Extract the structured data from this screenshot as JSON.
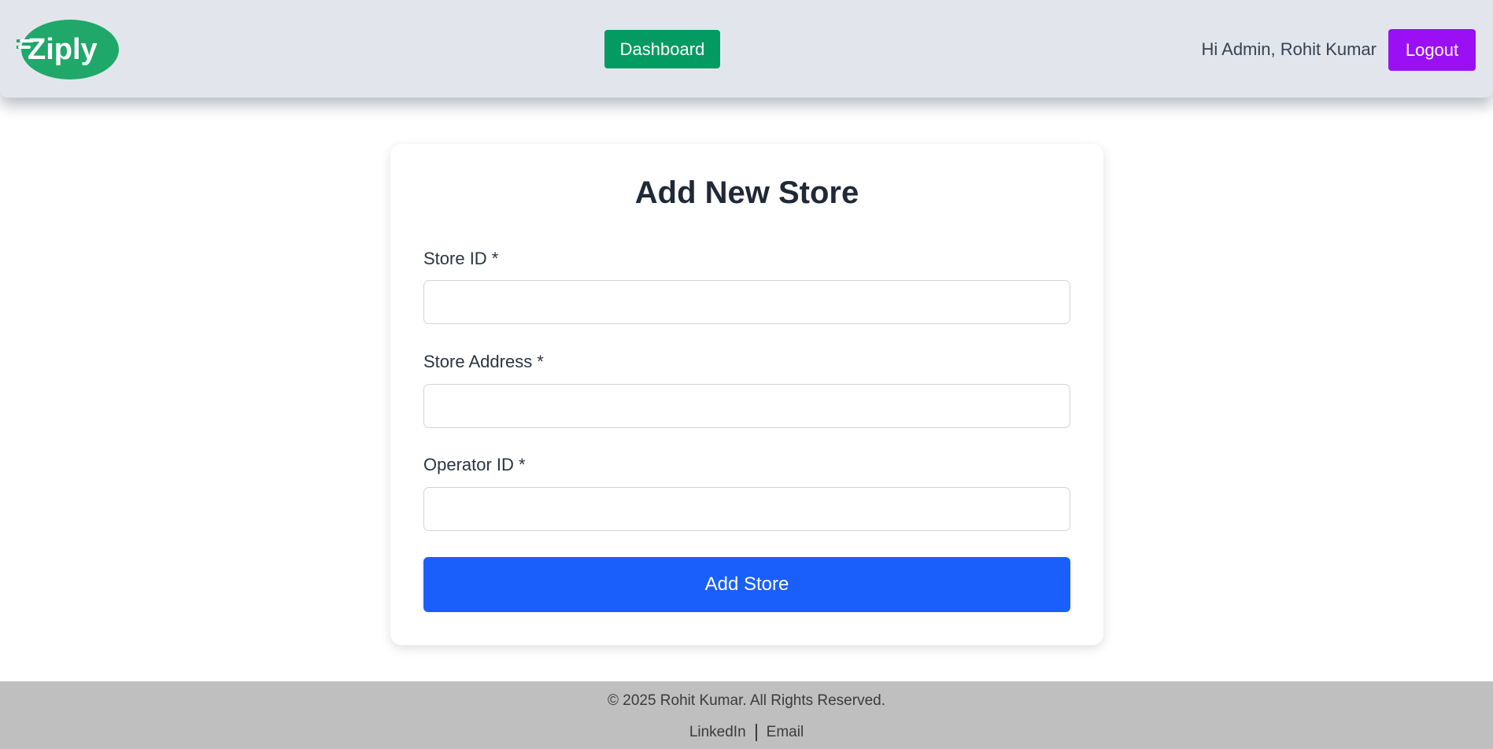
{
  "header": {
    "logo_text": "Ziply",
    "dashboard_label": "Dashboard",
    "greeting": "Hi Admin, Rohit Kumar",
    "logout_label": "Logout"
  },
  "form": {
    "title": "Add New Store",
    "fields": [
      {
        "label": "Store ID *",
        "value": "",
        "placeholder": ""
      },
      {
        "label": "Store Address *",
        "value": "",
        "placeholder": ""
      },
      {
        "label": "Operator ID *",
        "value": "",
        "placeholder": ""
      }
    ],
    "submit_label": "Add Store"
  },
  "footer": {
    "copyright": "© 2025 Rohit Kumar. All Rights Reserved.",
    "links": [
      "LinkedIn",
      "Email"
    ]
  },
  "colors": {
    "header_bg": "#e2e6ec",
    "dashboard_button": "#049b62",
    "logout_button": "#9b0ff5",
    "submit_button": "#1a5ffc",
    "footer_bg": "#bfbfbf",
    "logo_green": "#1fa86a"
  }
}
